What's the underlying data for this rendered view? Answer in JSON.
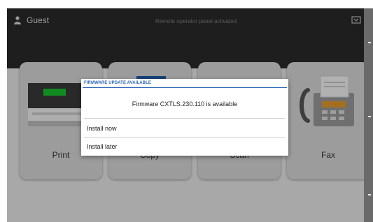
{
  "header": {
    "user_name": "Guest",
    "status_text": "Remote operator panel activated",
    "user_icon": "user-icon",
    "status_icon": "tray-icon"
  },
  "tiles": [
    {
      "label": "Print",
      "icon": "printer-icon"
    },
    {
      "label": "Copy",
      "icon": "copy-icon"
    },
    {
      "label": "Scan",
      "icon": "scan-icon"
    },
    {
      "label": "Fax",
      "icon": "fax-icon"
    }
  ],
  "dialog": {
    "title": "FIRMWARE UPDATE AVAILABLE",
    "message": "Firmware CXTLS.230.110 is available",
    "options": [
      "Install now",
      "Install later"
    ]
  },
  "colors": {
    "header_bg": "#2a2a2a",
    "screen_bg": "#e9e9e9",
    "tile_bg": "#d8d8d8",
    "dialog_accent": "#2a64b4",
    "printer_status_light": "#19c12e"
  }
}
